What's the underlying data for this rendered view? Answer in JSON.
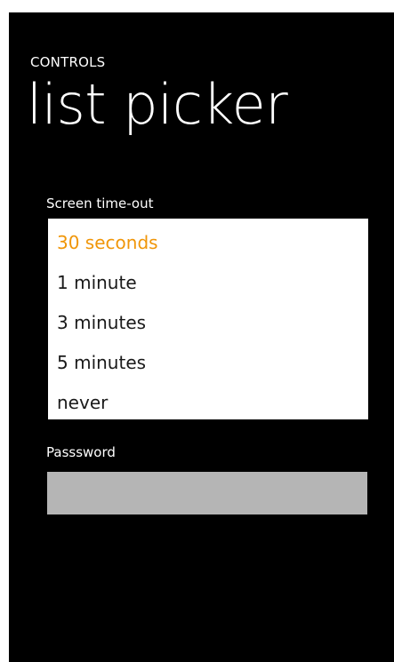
{
  "header": {
    "app_title": "CONTROLS",
    "page_title": "list picker"
  },
  "screen_timeout": {
    "label": "Screen time-out",
    "options": [
      {
        "label": "30 seconds",
        "selected": true
      },
      {
        "label": "1 minute",
        "selected": false
      },
      {
        "label": "3 minutes",
        "selected": false
      },
      {
        "label": "5 minutes",
        "selected": false
      },
      {
        "label": "never",
        "selected": false
      }
    ],
    "selected_color": "#f09609"
  },
  "password": {
    "label": "Passsword",
    "value": ""
  },
  "colors": {
    "background": "#000000",
    "accent": "#f09609",
    "picker_background": "#ffffff",
    "input_background": "#b5b5b5"
  }
}
